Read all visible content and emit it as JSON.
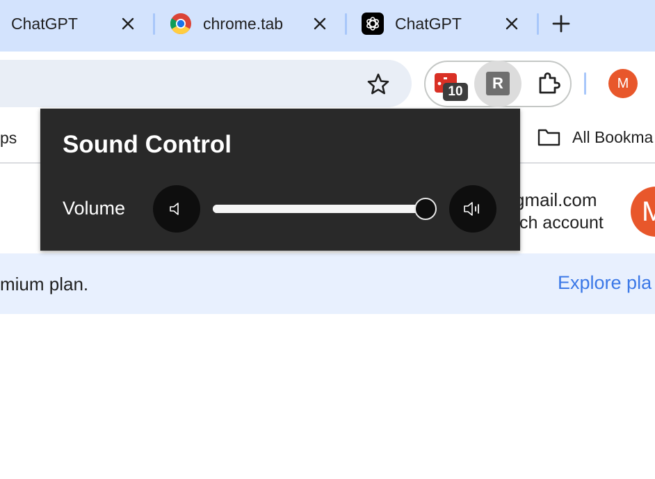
{
  "tabs": [
    {
      "title": "ChatGPT",
      "icon": "none"
    },
    {
      "title": "chrome.tab",
      "icon": "chrome-icon"
    },
    {
      "title": "ChatGPT",
      "icon": "openai-icon"
    }
  ],
  "new_tab_label": "+",
  "extensions": {
    "badge_count": "10",
    "r_extension_letter": "R"
  },
  "profile_initial": "M",
  "bookmarks": {
    "left_partial": "ps",
    "all_bookmarks_label": "All Bookma"
  },
  "page": {
    "account_email": "gmail.com",
    "switch_account": "tch account",
    "avatar_initial": "M",
    "banner_text": "mium plan.",
    "banner_link": "Explore pla"
  },
  "sound_control": {
    "title": "Sound Control",
    "volume_label": "Volume",
    "volume_level": 1.0
  },
  "colors": {
    "tabstrip": "#d3e3fd",
    "popup_bg": "#292929",
    "avatar": "#e8572b",
    "link": "#3b78e7",
    "banner": "#e8f0fe"
  }
}
